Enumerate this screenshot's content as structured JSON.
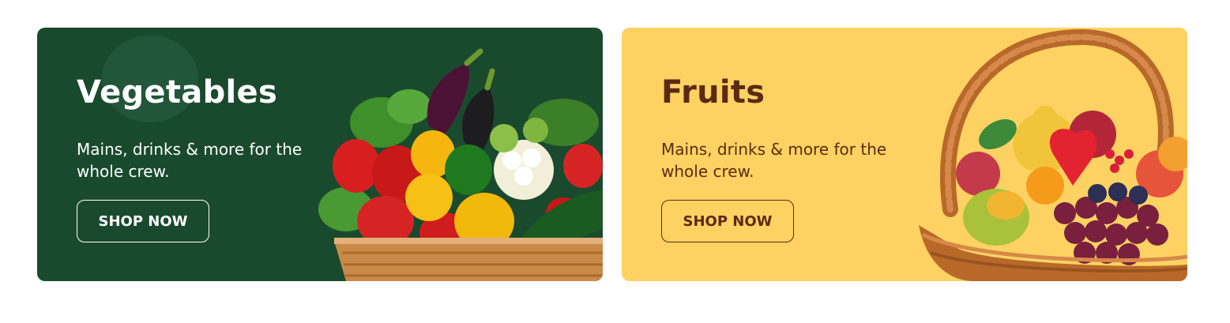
{
  "banners": [
    {
      "title": "Vegetables",
      "description": "Mains, drinks & more for the whole crew.",
      "button_label": "SHOP NOW",
      "image_icon": "vegetable-basket-icon",
      "colors": {
        "background": "#1a4a2e",
        "title": "#ffffff",
        "text": "#ffffff",
        "button_border": "#ffffff",
        "button_text": "#ffffff",
        "deco": "#22563a"
      }
    },
    {
      "title": "Fruits",
      "description": "Mains, drinks & more for the whole crew.",
      "button_label": "SHOP NOW",
      "image_icon": "fruit-basket-icon",
      "colors": {
        "background": "#fdd262",
        "title": "#5b2a14",
        "text": "#5b2a14",
        "button_border": "#5b2a14",
        "button_text": "#5b2a14"
      }
    }
  ]
}
